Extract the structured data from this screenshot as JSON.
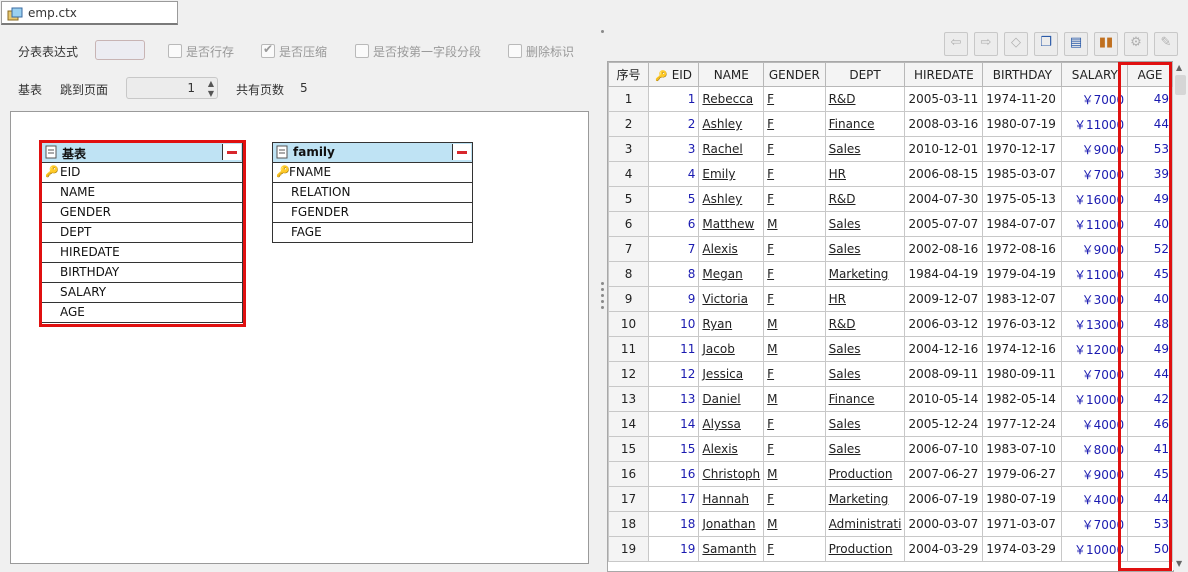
{
  "tab": {
    "label": "emp.ctx",
    "icon": "table-file-icon"
  },
  "left": {
    "expr_label": "分表表达式",
    "expr_value": "",
    "checkboxes": [
      {
        "label": "是否行存",
        "checked": false
      },
      {
        "label": "是否压缩",
        "checked": true
      },
      {
        "label": "是否按第一字段分段",
        "checked": false
      },
      {
        "label": "删除标识",
        "checked": false
      }
    ],
    "base_label": "基表",
    "jump_label": "跳到页面",
    "page_value": "1",
    "total_label": "共有页数",
    "total_value": "5"
  },
  "tables": [
    {
      "name": "基表",
      "fields": [
        "EID",
        "NAME",
        "GENDER",
        "DEPT",
        "HIREDATE",
        "BIRTHDAY",
        "SALARY",
        "AGE"
      ],
      "key_field": "EID"
    },
    {
      "name": "family",
      "fields": [
        "FNAME",
        "RELATION",
        "FGENDER",
        "FAGE"
      ],
      "key_field": "FNAME"
    }
  ],
  "toolbar": [
    "back-arrow-icon",
    "forward-arrow-icon",
    "clear-icon",
    "copy-icon",
    "grid-view-icon",
    "chart-icon",
    "settings-icon",
    "pin-icon"
  ],
  "grid": {
    "headers": [
      "序号",
      "EID",
      "NAME",
      "GENDER",
      "DEPT",
      "HIREDATE",
      "BIRTHDAY",
      "SALARY",
      "AGE"
    ],
    "rows": [
      [
        "1",
        "1",
        "Rebecca",
        "F",
        "R&D",
        "2005-03-11",
        "1974-11-20",
        "￥7000",
        "49"
      ],
      [
        "2",
        "2",
        "Ashley",
        "F",
        "Finance",
        "2008-03-16",
        "1980-07-19",
        "￥11000",
        "44"
      ],
      [
        "3",
        "3",
        "Rachel",
        "F",
        "Sales",
        "2010-12-01",
        "1970-12-17",
        "￥9000",
        "53"
      ],
      [
        "4",
        "4",
        "Emily",
        "F",
        "HR",
        "2006-08-15",
        "1985-03-07",
        "￥7000",
        "39"
      ],
      [
        "5",
        "5",
        "Ashley",
        "F",
        "R&D",
        "2004-07-30",
        "1975-05-13",
        "￥16000",
        "49"
      ],
      [
        "6",
        "6",
        "Matthew",
        "M",
        "Sales",
        "2005-07-07",
        "1984-07-07",
        "￥11000",
        "40"
      ],
      [
        "7",
        "7",
        "Alexis",
        "F",
        "Sales",
        "2002-08-16",
        "1972-08-16",
        "￥9000",
        "52"
      ],
      [
        "8",
        "8",
        "Megan",
        "F",
        "Marketing",
        "1984-04-19",
        "1979-04-19",
        "￥11000",
        "45"
      ],
      [
        "9",
        "9",
        "Victoria",
        "F",
        "HR",
        "2009-12-07",
        "1983-12-07",
        "￥3000",
        "40"
      ],
      [
        "10",
        "10",
        "Ryan",
        "M",
        "R&D",
        "2006-03-12",
        "1976-03-12",
        "￥13000",
        "48"
      ],
      [
        "11",
        "11",
        "Jacob",
        "M",
        "Sales",
        "2004-12-16",
        "1974-12-16",
        "￥12000",
        "49"
      ],
      [
        "12",
        "12",
        "Jessica",
        "F",
        "Sales",
        "2008-09-11",
        "1980-09-11",
        "￥7000",
        "44"
      ],
      [
        "13",
        "13",
        "Daniel",
        "M",
        "Finance",
        "2010-05-14",
        "1982-05-14",
        "￥10000",
        "42"
      ],
      [
        "14",
        "14",
        "Alyssa",
        "F",
        "Sales",
        "2005-12-24",
        "1977-12-24",
        "￥4000",
        "46"
      ],
      [
        "15",
        "15",
        "Alexis",
        "F",
        "Sales",
        "2006-07-10",
        "1983-07-10",
        "￥8000",
        "41"
      ],
      [
        "16",
        "16",
        "Christoph",
        "M",
        "Production",
        "2007-06-27",
        "1979-06-27",
        "￥9000",
        "45"
      ],
      [
        "17",
        "17",
        "Hannah",
        "F",
        "Marketing",
        "2006-07-19",
        "1980-07-19",
        "￥4000",
        "44"
      ],
      [
        "18",
        "18",
        "Jonathan",
        "M",
        "Administrati",
        "2000-03-07",
        "1971-03-07",
        "￥7000",
        "53"
      ],
      [
        "19",
        "19",
        "Samanth",
        "F",
        "Production",
        "2004-03-29",
        "1974-03-29",
        "￥10000",
        "50"
      ]
    ]
  },
  "colors": {
    "highlight": "#e01010",
    "table_header": "#bfe3f4",
    "value_blue": "#1a1ab0"
  }
}
